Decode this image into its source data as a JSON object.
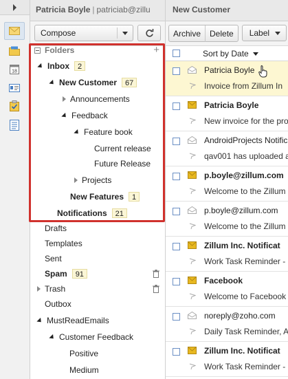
{
  "account": {
    "name": "Patricia Boyle",
    "separator": "|",
    "email": "patriciab@zillu"
  },
  "toolbar_left": {
    "compose_label": "Compose"
  },
  "folders": {
    "header": "Folders",
    "add_icon": "plus-icon",
    "items": [
      {
        "label": "Inbox",
        "count": "2"
      },
      {
        "label": "New Customer",
        "count": "67"
      },
      {
        "label": "Announcements"
      },
      {
        "label": "Feedback"
      },
      {
        "label": "Feature book"
      },
      {
        "label": "Current release"
      },
      {
        "label": "Future Release"
      },
      {
        "label": "Projects"
      },
      {
        "label": "New Features",
        "count": "1"
      },
      {
        "label": "Notifications",
        "count": "21"
      },
      {
        "label": "Drafts"
      },
      {
        "label": "Templates"
      },
      {
        "label": "Sent"
      },
      {
        "label": "Spam",
        "count": "91"
      },
      {
        "label": "Trash"
      },
      {
        "label": "Outbox"
      },
      {
        "label": "MustReadEmails"
      },
      {
        "label": "Customer Feedback"
      },
      {
        "label": "Positive"
      },
      {
        "label": "Medium"
      }
    ]
  },
  "message_pane": {
    "title": "New Customer",
    "archive_label": "Archive",
    "delete_label": "Delete",
    "label_label": "Label",
    "sort_label": "Sort by Date"
  },
  "messages": [
    {
      "from": "Patricia Boyle",
      "subject": "Invoice from Zillum In",
      "unread": false,
      "selected": true
    },
    {
      "from": "Patricia Boyle",
      "subject": "New invoice for the pro",
      "unread": true,
      "selected": false
    },
    {
      "from": "AndroidProjects Notific",
      "subject": "qav001 has uploaded a",
      "unread": false,
      "selected": false
    },
    {
      "from": "p.boyle@zillum.com",
      "subject": "Welcome to the Zillum",
      "unread": true,
      "selected": false
    },
    {
      "from": "p.boyle@zillum.com",
      "subject": "Welcome to the Zillum",
      "unread": false,
      "selected": false
    },
    {
      "from": "Zillum Inc. Notificat",
      "subject": "Work Task Reminder -",
      "unread": true,
      "selected": false
    },
    {
      "from": "Facebook",
      "subject": "Welcome to Facebook",
      "unread": true,
      "selected": false
    },
    {
      "from": "noreply@zoho.com",
      "subject": "Daily Task Reminder, A",
      "unread": false,
      "selected": false
    },
    {
      "from": "Zillum Inc. Notificat",
      "subject": "Work Task Reminder -",
      "unread": true,
      "selected": false
    }
  ],
  "rail": {
    "icons": [
      "mail-icon",
      "folder-icon",
      "calendar-icon",
      "contacts-icon",
      "tasks-icon",
      "notes-icon"
    ]
  },
  "colors": {
    "highlight_border": "#d0312d",
    "count_badge": "#fbf6d6",
    "selected_row": "#fdf7d2",
    "unread_envelope": "#e8b820"
  }
}
